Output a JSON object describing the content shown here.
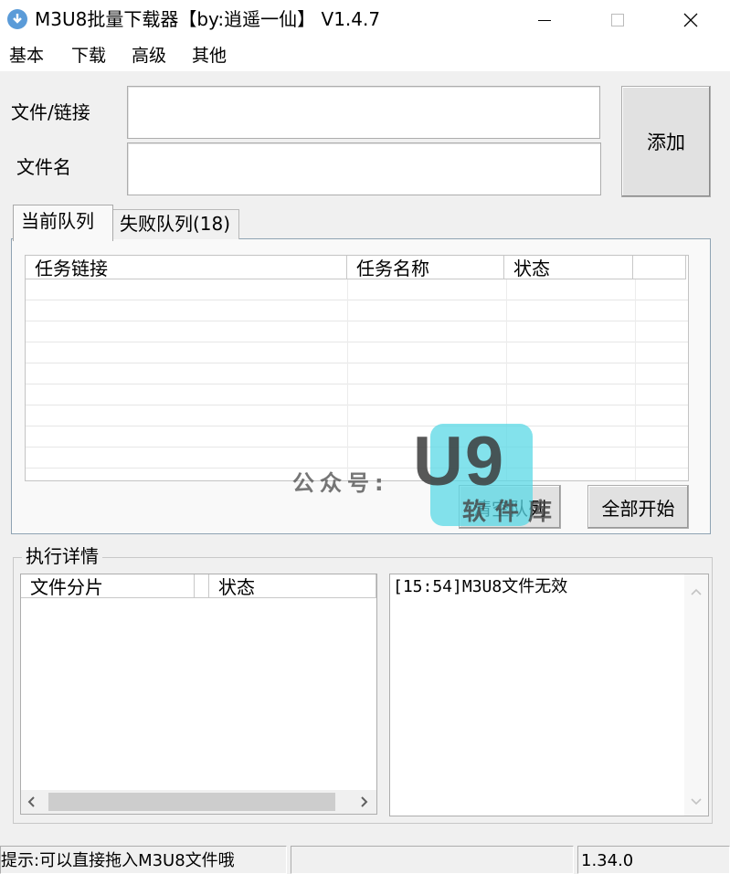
{
  "window": {
    "title": "M3U8批量下载器【by:逍遥一仙】 V1.4.7",
    "controls": [
      "minimize",
      "maximize",
      "close"
    ]
  },
  "menu": {
    "items": [
      "基本",
      "下载",
      "高级",
      "其他"
    ]
  },
  "form": {
    "file_link_label": "文件/链接",
    "file_link_value": "",
    "file_name_label": "文件名",
    "file_name_value": "",
    "add_button_label": "添加"
  },
  "tabs": [
    {
      "label": "当前队列",
      "active": true
    },
    {
      "label": "失败队列(18)",
      "active": false
    }
  ],
  "queue_table": {
    "columns": [
      "任务链接",
      "任务名称",
      "状态",
      ""
    ],
    "rows": []
  },
  "buttons": {
    "clear_queue": "清空队列",
    "start_all": "全部开始"
  },
  "details": {
    "group_label": "执行详情",
    "fragment_columns": [
      "文件分片",
      "",
      "状态"
    ],
    "log_lines": [
      "[15:54]M3U8文件无效"
    ]
  },
  "statusbar": {
    "hint": "提示:可以直接拖入M3U8文件哦",
    "middle": "",
    "version": "1.34.0"
  },
  "watermark": {
    "left_text": "公众号:",
    "logo_text": "U9",
    "bottom_text": "软件库"
  },
  "colors": {
    "app_icon": "#5a9bd8",
    "watermark_cyan": "#5ad8e6"
  }
}
